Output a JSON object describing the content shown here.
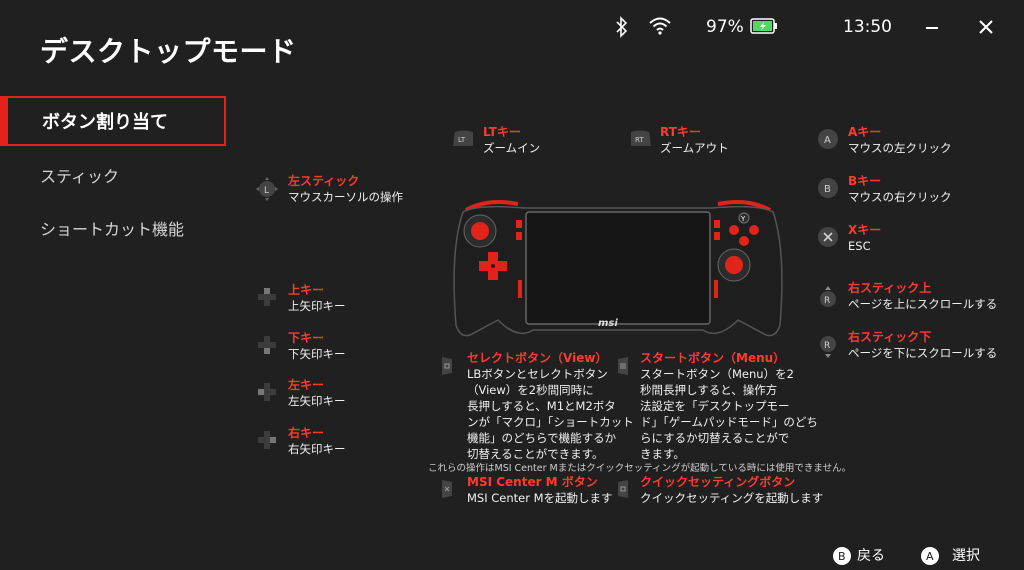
{
  "title": "デスクトップモード",
  "status": {
    "battery": "97%",
    "time": "13:50"
  },
  "nav": [
    {
      "label": "ボタン割り当て"
    },
    {
      "label": "スティック"
    },
    {
      "label": "ショートカット機能"
    }
  ],
  "mappings": {
    "lt": {
      "title": "LTキー",
      "desc": "ズームイン"
    },
    "rt": {
      "title": "RTキー",
      "desc": "ズームアウト"
    },
    "a": {
      "title": "Aキー",
      "desc": "マウスの左クリック"
    },
    "b": {
      "title": "Bキー",
      "desc": "マウスの右クリック"
    },
    "x": {
      "title": "Xキー",
      "desc": "ESC"
    },
    "left_stick": {
      "title": "左スティック",
      "desc": "マウスカーソルの操作"
    },
    "up": {
      "title": "上キー",
      "desc": "上矢印キー"
    },
    "down": {
      "title": "下キー",
      "desc": "下矢印キー"
    },
    "left": {
      "title": "左キー",
      "desc": "左矢印キー"
    },
    "right": {
      "title": "右キー",
      "desc": "右矢印キー"
    },
    "rs_up": {
      "title": "右スティック上",
      "desc": "ページを上にスクロールする"
    },
    "rs_down": {
      "title": "右スティック下",
      "desc": "ページを下にスクロールする"
    },
    "select": {
      "title": "セレクトボタン（View）",
      "lines": [
        "LBボタンとセレクトボタン",
        "（View）を2秒間同時に",
        "長押しすると、M1とM2ボタ",
        "ンが「マクロ」「ショートカット",
        "機能」のどちらで機能するか",
        "切替えることができます。"
      ]
    },
    "start": {
      "title": "スタートボタン（Menu）",
      "lines": [
        "スタートボタン（Menu）を2",
        "秒間長押しすると、操作方",
        "法設定を「デスクトップモー",
        "ド」「ゲームパッドモード」のどち",
        "らにするか切替えることがで",
        "きます。"
      ]
    },
    "msi_center": {
      "title": "MSI Center M ボタン",
      "desc": "MSI Center Mを起動します"
    },
    "quick": {
      "title": "クイックセッティングボタン",
      "desc": "クイックセッティングを起動します"
    }
  },
  "notice": "これらの操作はMSI Center Mまたはクイックセッティングが起動している時には使用できません。",
  "bottom": {
    "back": "戻る",
    "select": "選択"
  },
  "device_logo": "msi",
  "colors": {
    "accent": "#e2231a",
    "battery": "#4cd964"
  }
}
